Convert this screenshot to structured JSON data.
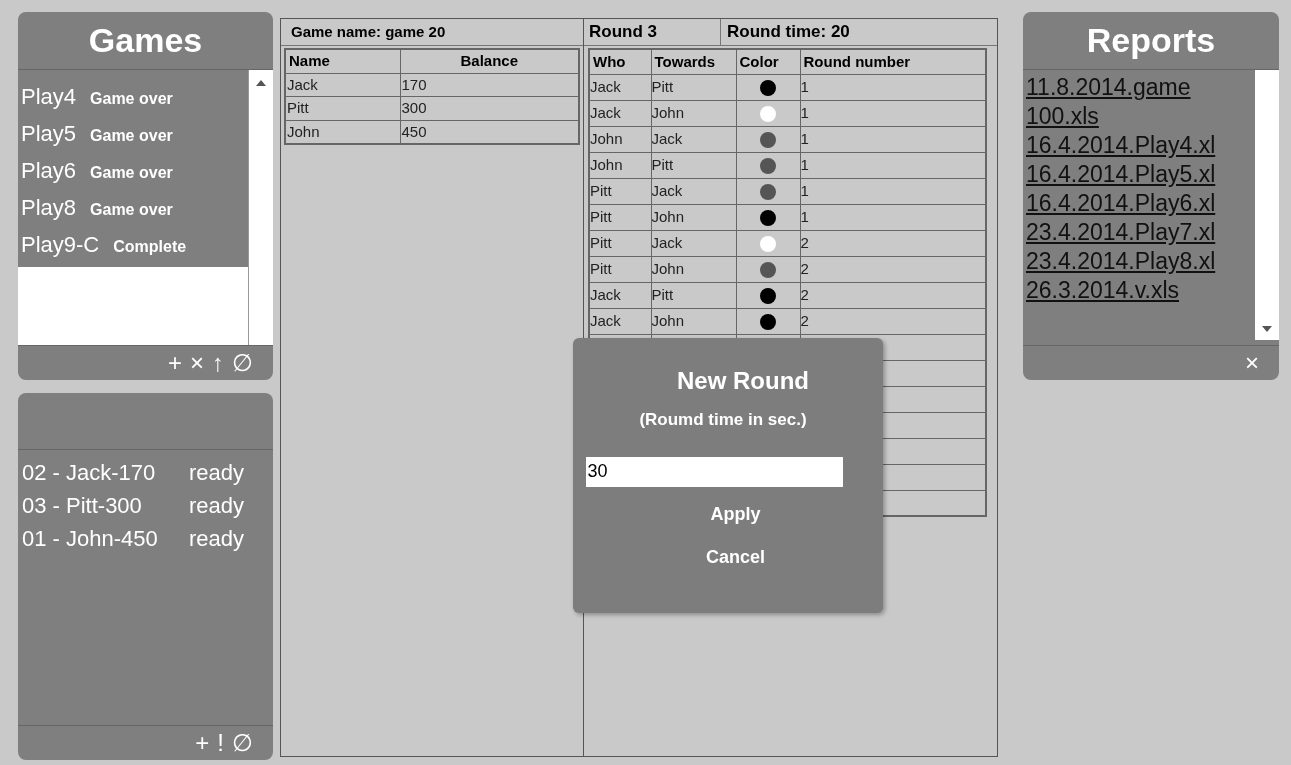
{
  "games_panel": {
    "title": "Games",
    "items": [
      {
        "name": "Play4",
        "status": "Game over"
      },
      {
        "name": "Play5",
        "status": "Game over"
      },
      {
        "name": "Play6",
        "status": "Game over"
      },
      {
        "name": "Play8",
        "status": "Game over"
      },
      {
        "name": "Play9-C",
        "status": "Complete"
      }
    ],
    "actions": [
      "+",
      "×",
      "↑",
      "∅"
    ]
  },
  "players_panel": {
    "items": [
      {
        "label": "02 - Jack-170",
        "status": "ready"
      },
      {
        "label": "03 - Pitt-300",
        "status": "ready"
      },
      {
        "label": "01 - John-450",
        "status": "ready"
      }
    ],
    "actions": [
      "+",
      "!",
      "∅"
    ]
  },
  "game": {
    "title": "Game name: game 20",
    "columns": [
      "Name",
      "Balance"
    ],
    "rows": [
      [
        "Jack",
        "170"
      ],
      [
        "Pitt",
        "300"
      ],
      [
        "John",
        "450"
      ]
    ]
  },
  "rounds": {
    "round": "Round 3",
    "round_time": "Round time: 20",
    "columns": [
      "Who",
      "Towards",
      "Color",
      "Round number"
    ],
    "rows": [
      {
        "who": "Jack",
        "towards": "Pitt",
        "color": "#000000",
        "round": "1"
      },
      {
        "who": "Jack",
        "towards": "John",
        "color": "#ffffff",
        "round": "1"
      },
      {
        "who": "John",
        "towards": "Jack",
        "color": "#555555",
        "round": "1"
      },
      {
        "who": "John",
        "towards": "Pitt",
        "color": "#555555",
        "round": "1"
      },
      {
        "who": "Pitt",
        "towards": "Jack",
        "color": "#555555",
        "round": "1"
      },
      {
        "who": "Pitt",
        "towards": "John",
        "color": "#000000",
        "round": "1"
      },
      {
        "who": "Pitt",
        "towards": "Jack",
        "color": "#ffffff",
        "round": "2"
      },
      {
        "who": "Pitt",
        "towards": "John",
        "color": "#555555",
        "round": "2"
      },
      {
        "who": "Jack",
        "towards": "Pitt",
        "color": "#000000",
        "round": "2"
      },
      {
        "who": "Jack",
        "towards": "John",
        "color": "#000000",
        "round": "2"
      }
    ]
  },
  "reports_panel": {
    "title": "Reports",
    "items": [
      "11.8.2014.game 100.xls",
      "16.4.2014.Play4.xl",
      "16.4.2014.Play5.xl",
      "16.4.2014.Play6.xl",
      "23.4.2014.Play7.xl",
      "23.4.2014.Play8.xl",
      "26.3.2014.v.xls"
    ],
    "actions": [
      "×"
    ]
  },
  "dialog": {
    "title": "New Round",
    "subtitle": "(Roumd time in sec.)",
    "value": "30",
    "buttons": [
      "Apply",
      "Cancel"
    ]
  }
}
